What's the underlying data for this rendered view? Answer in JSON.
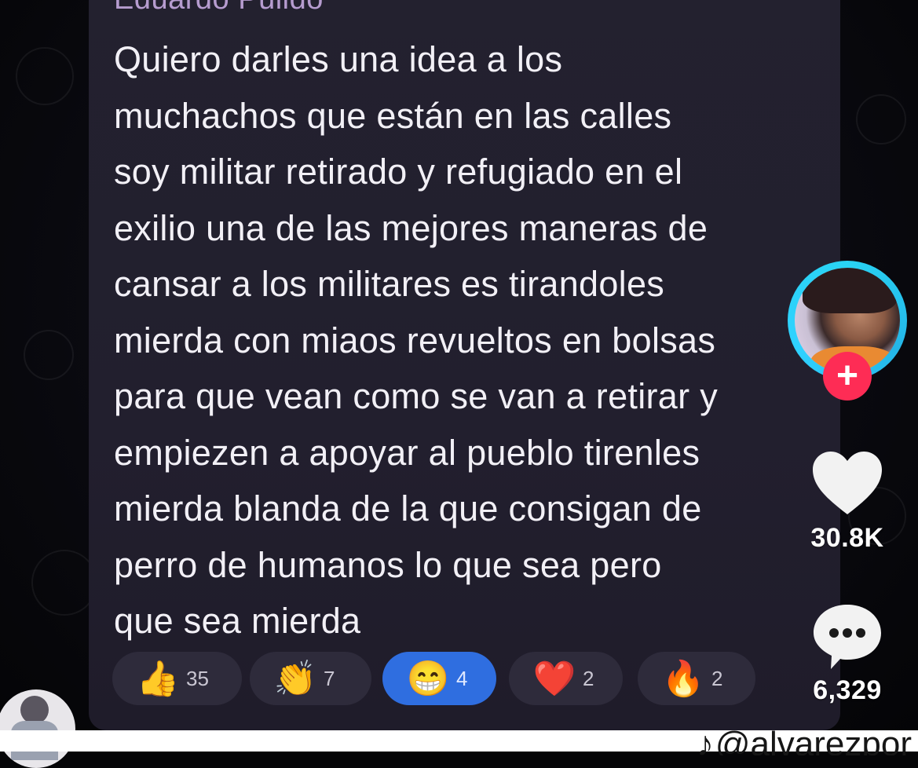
{
  "message": {
    "author": "Eduardo Pulido",
    "lines": [
      "Quiero darles una idea a los",
      "muchachos que están en las calles",
      "soy militar retirado y refugiado en el",
      "exilio una de las mejores maneras de",
      "cansar a los militares es tirandoles",
      "mierda con miaos revueltos en bolsas",
      "para que vean como se van a retirar y",
      "empiezen a apoyar al pueblo tirenles",
      "mierda blanda de la que consigan de",
      "perro de humanos lo que sea pero",
      "que sea mierda"
    ]
  },
  "reactions": [
    {
      "emoji": "👍",
      "count": "35",
      "icon": "thumbs-up-icon"
    },
    {
      "emoji": "👏",
      "count": "7",
      "icon": "clapping-hands-icon"
    },
    {
      "emoji": "😁",
      "count": "4",
      "icon": "grinning-face-icon",
      "active": true
    },
    {
      "emoji": "❤️",
      "count": "2",
      "icon": "red-heart-icon"
    },
    {
      "emoji": "🔥",
      "count": "2",
      "icon": "fire-icon"
    }
  ],
  "tiktok": {
    "follow_symbol": "+",
    "likes": "30.8K",
    "comments": "6,329",
    "watermark_logo": "♪",
    "watermark_handle": "@alvarezpor"
  },
  "colors": {
    "bubble": "#23212f",
    "author": "#b69ccf",
    "active_reaction": "#2f6ee0",
    "follow_button": "#fe2c55",
    "avatar_ring": "#29d3f3"
  }
}
